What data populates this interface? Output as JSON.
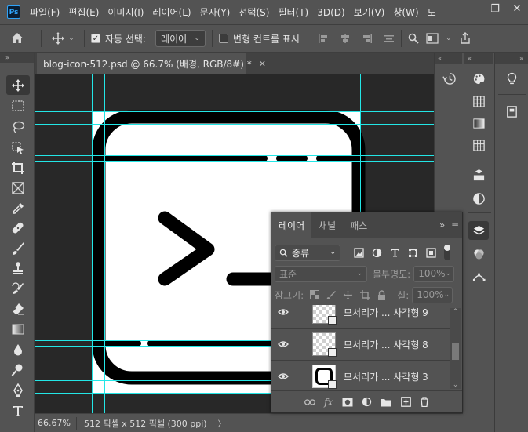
{
  "app": {
    "logo": "Ps"
  },
  "menu": [
    "파일(F)",
    "편집(E)",
    "이미지(I)",
    "레이어(L)",
    "문자(Y)",
    "선택(S)",
    "필터(T)",
    "3D(D)",
    "보기(V)",
    "창(W)",
    "도"
  ],
  "window_controls": {
    "minimize": "—",
    "restore": "❐",
    "close": "✕"
  },
  "options": {
    "auto_select_label": "자동 선택:",
    "auto_select_value": "레이어",
    "transform_label": "변형 컨트롤 표시"
  },
  "document": {
    "tab_title": "blog-icon-512.psd @ 66.7% (배경, RGB/8#) *",
    "close_label": "✕",
    "zoom": "66.67%",
    "info": "512 픽셀 x 512 픽셀 (300 ppi)",
    "info_arrow": "〉"
  },
  "layers_panel": {
    "tabs": [
      "레이어",
      "채널",
      "패스"
    ],
    "filter_kind": "종류",
    "blend_mode": "표준",
    "opacity_label": "불투명도:",
    "opacity_value": "100%",
    "lock_label": "잠그기:",
    "fill_label": "칠:",
    "fill_value": "100%",
    "layers": [
      {
        "name": "모서리가 ... 사각형 9"
      },
      {
        "name": "모서리가 ... 사각형 8"
      },
      {
        "name": "모서리가 ... 사각형 3"
      }
    ]
  },
  "colors": {
    "ui_bg": "#535353",
    "canvas_bg": "#282828",
    "guide": "#00ffff",
    "accent": "#31a8ff"
  }
}
